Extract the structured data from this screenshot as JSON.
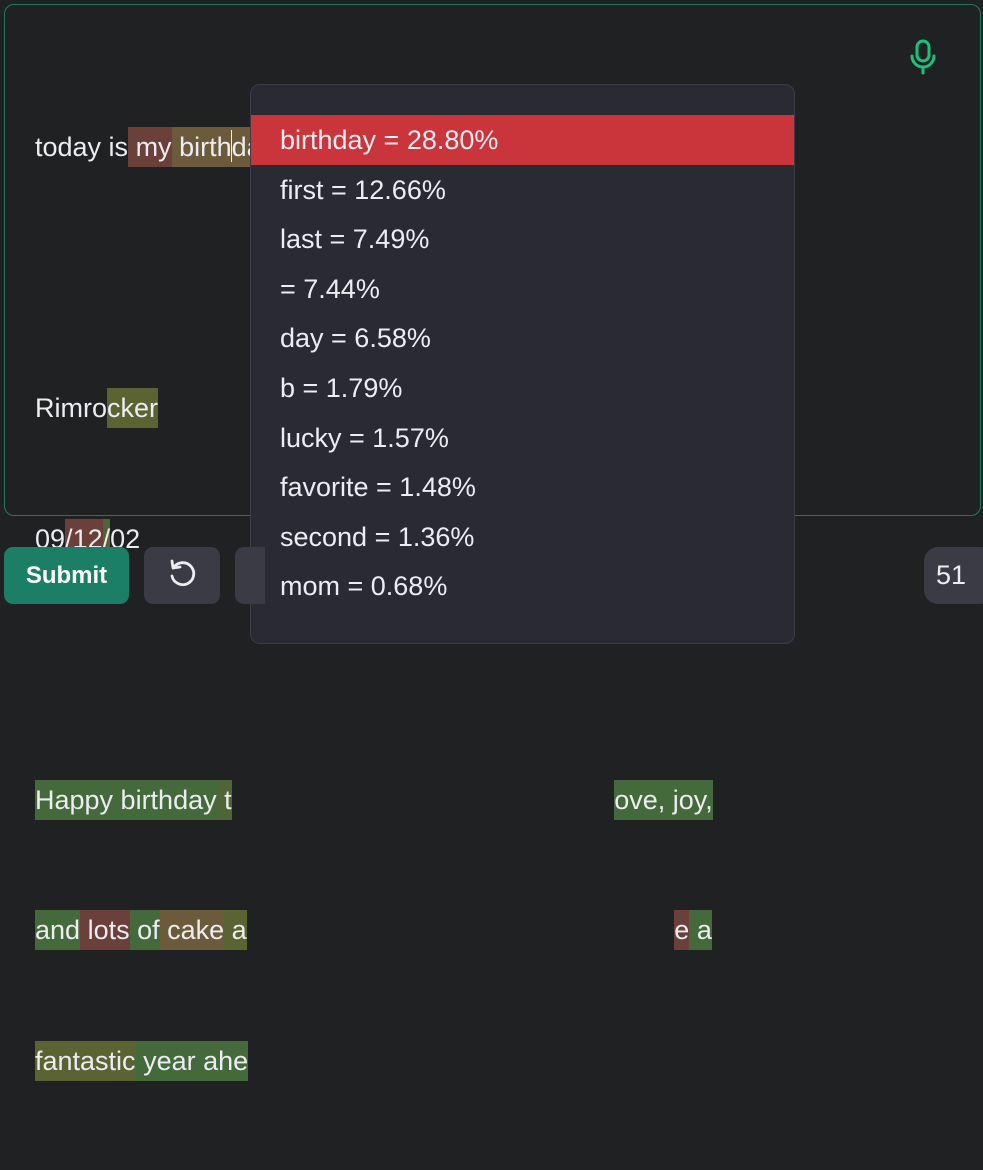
{
  "editor": {
    "line1": [
      {
        "text": "today is",
        "tone": ""
      },
      {
        "text": " my",
        "tone": "t-r"
      },
      {
        "text": " birth",
        "tone": "t-o"
      },
      {
        "text": "day",
        "tone": "t-o"
      },
      {
        "text": "!",
        "tone": "t-r"
      }
    ],
    "line3": [
      {
        "text": "Rimro",
        "tone": ""
      },
      {
        "text": "cker",
        "tone": "t-y"
      }
    ],
    "line4": [
      {
        "text": "09",
        "tone": ""
      },
      {
        "text": "/",
        "tone": "t-r"
      },
      {
        "text": "12",
        "tone": "t-r"
      },
      {
        "text": "/",
        "tone": "t-g"
      },
      {
        "text": "02",
        "tone": ""
      }
    ],
    "line6": [
      {
        "text": "Happy",
        "tone": "t-gg"
      },
      {
        "text": " birthday",
        "tone": "t-gg"
      },
      {
        "text": " t",
        "tone": "t-g"
      },
      {
        "text": "                                                   ",
        "tone": ""
      },
      {
        "text": "ove,",
        "tone": "t-gg"
      },
      {
        "text": " joy,",
        "tone": "t-gg"
      }
    ],
    "line7": [
      {
        "text": "and",
        "tone": "t-gg"
      },
      {
        "text": " lots",
        "tone": "t-r"
      },
      {
        "text": " of",
        "tone": "t-gg"
      },
      {
        "text": " cake",
        "tone": "t-o"
      },
      {
        "text": " a",
        "tone": "t-y"
      },
      {
        "text": "                                                         ",
        "tone": ""
      },
      {
        "text": "e",
        "tone": "t-r"
      },
      {
        "text": " a",
        "tone": "t-gg"
      }
    ],
    "line8": [
      {
        "text": "fantastic",
        "tone": "t-y"
      },
      {
        "text": " year",
        "tone": "t-gg"
      },
      {
        "text": " ahe",
        "tone": "t-gg"
      }
    ]
  },
  "popup": {
    "items": [
      {
        "label": "birthday = 28.80%",
        "selected": true
      },
      {
        "label": "first = 12.66%",
        "selected": false
      },
      {
        "label": "last = 7.49%",
        "selected": false
      },
      {
        "label": " = 7.44%",
        "selected": false
      },
      {
        "label": "day = 6.58%",
        "selected": false
      },
      {
        "label": "b = 1.79%",
        "selected": false
      },
      {
        "label": "lucky = 1.57%",
        "selected": false
      },
      {
        "label": "favorite = 1.48%",
        "selected": false
      },
      {
        "label": "second = 1.36%",
        "selected": false
      },
      {
        "label": "mom = 0.68%",
        "selected": false
      }
    ]
  },
  "toolbar": {
    "submit_label": "Submit",
    "token_count": "51"
  },
  "icons": {
    "mic": "microphone-icon",
    "reset": "reset-icon"
  },
  "colors": {
    "accent": "#19c37d",
    "submit_bg": "#1a7f64",
    "selected_bg": "#c9353b",
    "border": "#1f7a5c"
  }
}
